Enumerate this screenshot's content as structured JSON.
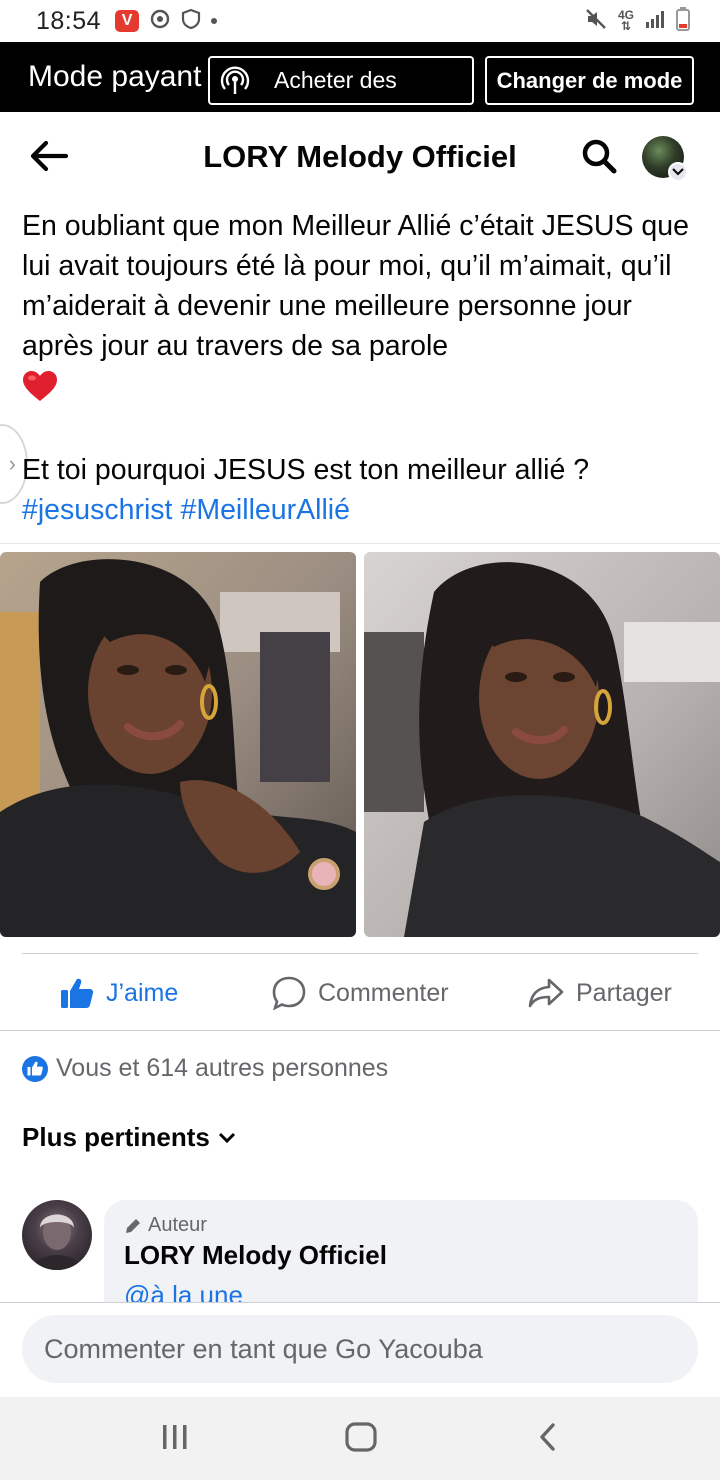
{
  "status_bar": {
    "time": "18:54",
    "network": "4G",
    "icons": [
      "vivaldi-icon",
      "sync-icon",
      "shield-icon",
      "dot-icon",
      "mute-icon",
      "signal-icon",
      "battery-icon"
    ]
  },
  "mode_bar": {
    "label": "Mode payant",
    "buy_label": "Acheter des",
    "change_label": "Changer de mode"
  },
  "header": {
    "title": "LORY Melody Officiel",
    "icons": [
      "back-arrow-icon",
      "search-icon",
      "profile-avatar"
    ]
  },
  "post": {
    "text": "En oubliant que mon Meilleur Allié c’était JESUS que lui avait toujours été là pour moi, qu’il m’aimait, qu’il m’aiderait à devenir une meilleure personne jour après jour au travers de sa parole",
    "question": "Et toi pourquoi JESUS est ton meilleur allié ?",
    "hashtags": [
      "#jesuschrist",
      "#MeilleurAllié"
    ]
  },
  "actions": {
    "like": "J’aime",
    "comment": "Commenter",
    "share": "Partager"
  },
  "reactions": {
    "summary": "Vous et 614 autres personnes"
  },
  "comments_sort": {
    "label": "Plus pertinents"
  },
  "comment": {
    "badge": "Auteur",
    "author": "LORY Melody Officiel",
    "text": "@à la une"
  },
  "composer": {
    "placeholder": "Commenter en tant que Go Yacouba"
  },
  "colors": {
    "facebook_blue": "#1b74e4",
    "mode_bar_bg": "#000000",
    "bubble_bg": "#f0f2f5"
  }
}
